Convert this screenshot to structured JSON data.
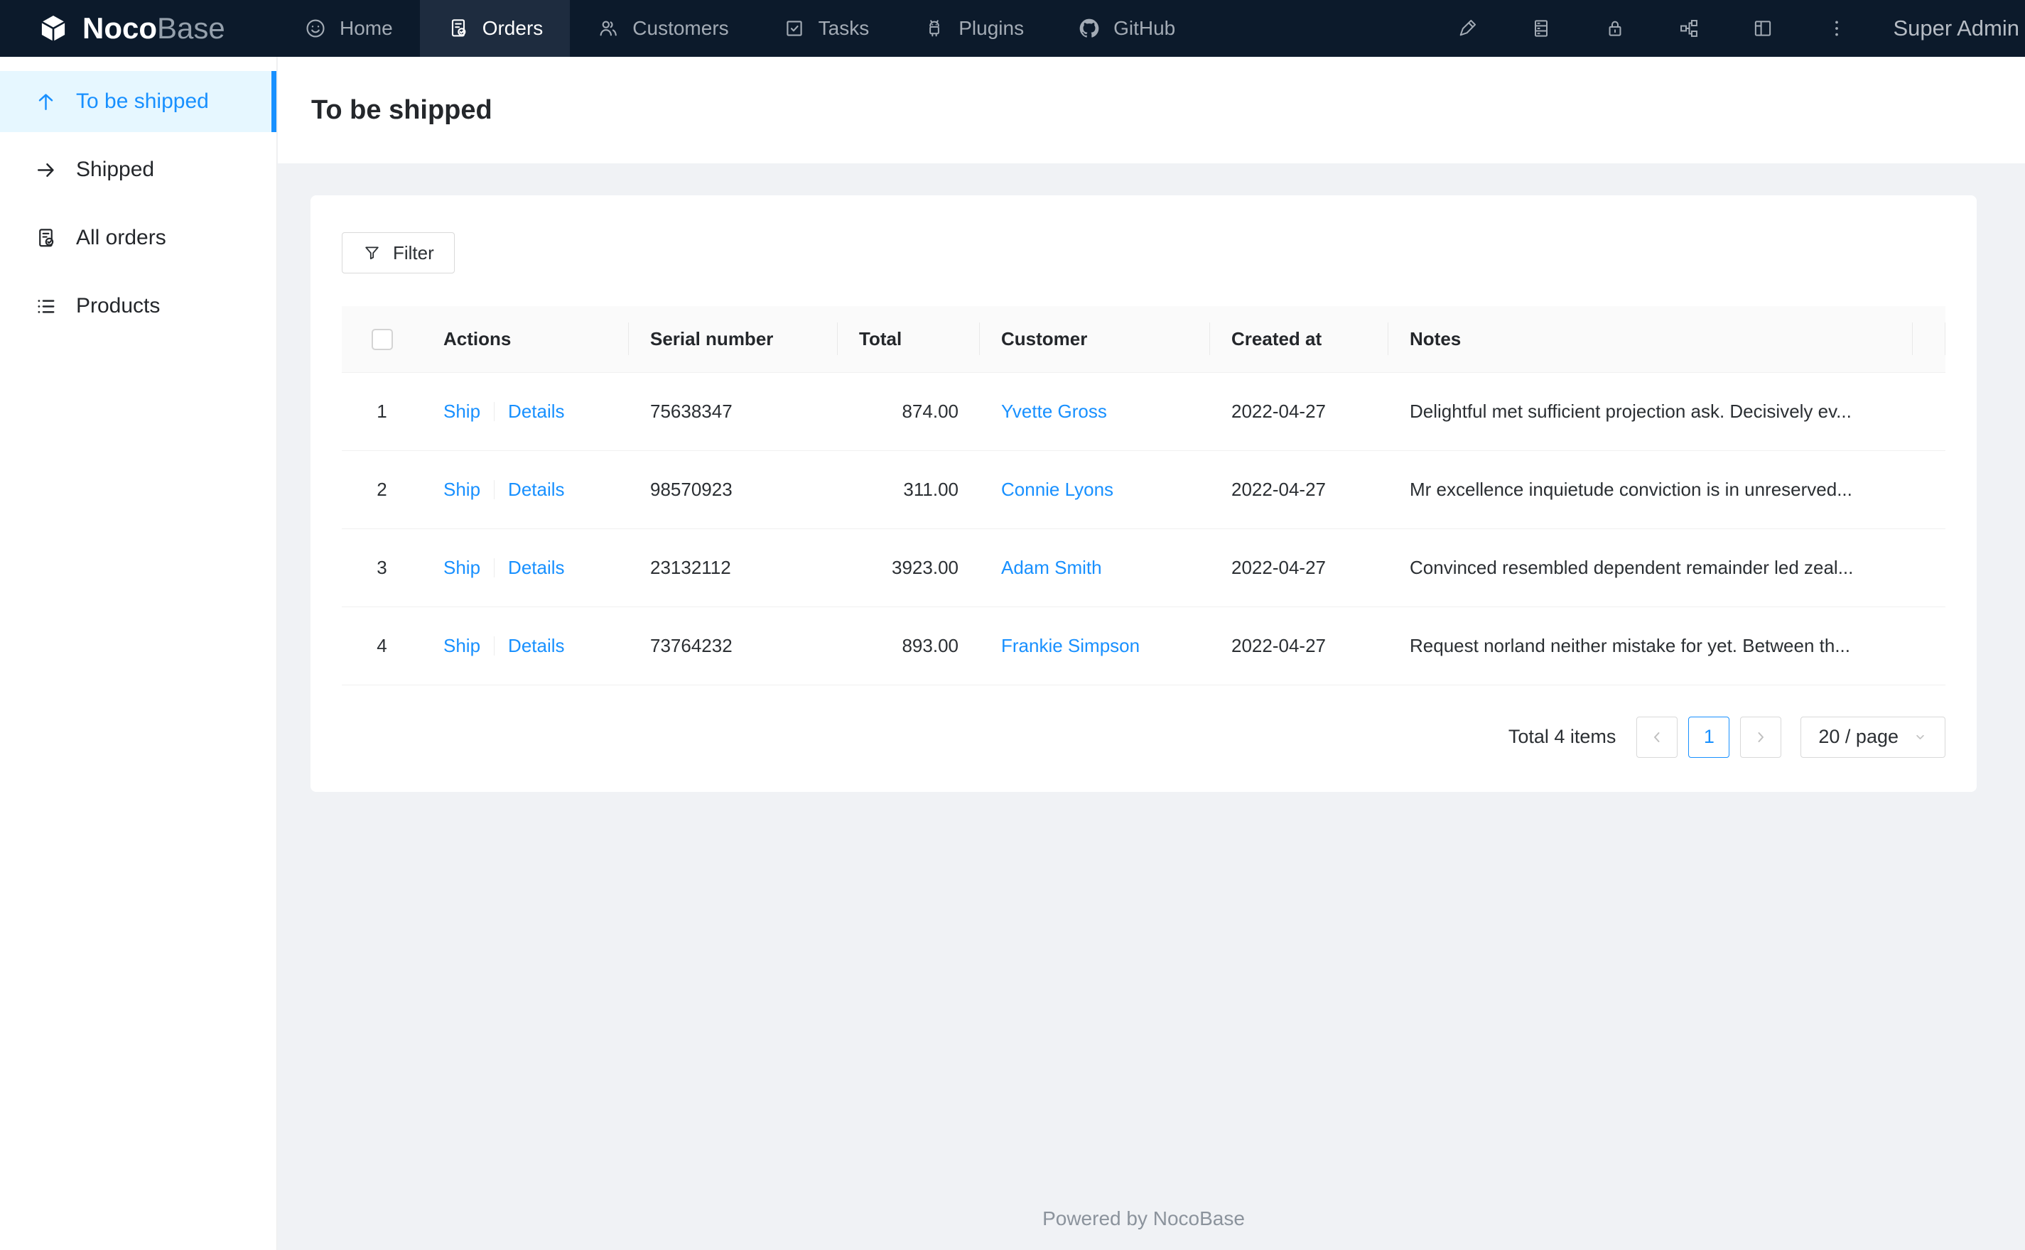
{
  "navbar": {
    "logo": {
      "text_bold": "Noco",
      "text_light": "Base"
    },
    "items": [
      {
        "label": "Home",
        "icon": "smiley-icon",
        "active": false
      },
      {
        "label": "Orders",
        "icon": "document-check-icon",
        "active": true
      },
      {
        "label": "Customers",
        "icon": "people-icon",
        "active": false
      },
      {
        "label": "Tasks",
        "icon": "checkbox-check-icon",
        "active": false
      },
      {
        "label": "Plugins",
        "icon": "robot-icon",
        "active": false
      },
      {
        "label": "GitHub",
        "icon": "github-icon",
        "active": false
      }
    ],
    "right_icons": [
      "highlighter-icon",
      "database-icon",
      "lock-icon",
      "api-graph-icon",
      "layout-icon",
      "more-vertical-icon"
    ],
    "user": "Super Admin"
  },
  "sidebar": {
    "items": [
      {
        "label": "To be shipped",
        "icon": "arrow-up-icon",
        "active": true
      },
      {
        "label": "Shipped",
        "icon": "arrow-right-icon",
        "active": false
      },
      {
        "label": "All orders",
        "icon": "document-check-icon",
        "active": false
      },
      {
        "label": "Products",
        "icon": "list-icon",
        "active": false
      }
    ]
  },
  "page": {
    "title": "To be shipped"
  },
  "toolbar": {
    "filter_label": "Filter"
  },
  "table": {
    "headers": [
      "Actions",
      "Serial number",
      "Total",
      "Customer",
      "Created at",
      "Notes"
    ],
    "rows": [
      {
        "index": "1",
        "actions": [
          "Ship",
          "Details"
        ],
        "serial": "75638347",
        "total": "874.00",
        "customer": "Yvette Gross",
        "created_at": "2022-04-27",
        "notes": "Delightful met sufficient projection ask. Decisively ev..."
      },
      {
        "index": "2",
        "actions": [
          "Ship",
          "Details"
        ],
        "serial": "98570923",
        "total": "311.00",
        "customer": "Connie Lyons",
        "created_at": "2022-04-27",
        "notes": "Mr excellence inquietude conviction is in unreserved..."
      },
      {
        "index": "3",
        "actions": [
          "Ship",
          "Details"
        ],
        "serial": "23132112",
        "total": "3923.00",
        "customer": "Adam Smith",
        "created_at": "2022-04-27",
        "notes": "Convinced resembled dependent remainder led zeal..."
      },
      {
        "index": "4",
        "actions": [
          "Ship",
          "Details"
        ],
        "serial": "73764232",
        "total": "893.00",
        "customer": "Frankie Simpson",
        "created_at": "2022-04-27",
        "notes": "Request norland neither mistake for yet. Between th..."
      }
    ]
  },
  "pagination": {
    "total_label": "Total 4 items",
    "current_page": "1",
    "page_size_label": "20 / page"
  },
  "footer": {
    "text": "Powered by NocoBase"
  },
  "colors": {
    "accent": "#1890ff",
    "navbar_bg": "#0c1a2b",
    "navbar_active_bg": "#1e2c3f",
    "sidebar_active_bg": "#e6f7ff",
    "content_bg": "#f0f2f5",
    "table_header_bg": "#fafafa",
    "row_border": "#f0f0f0"
  }
}
